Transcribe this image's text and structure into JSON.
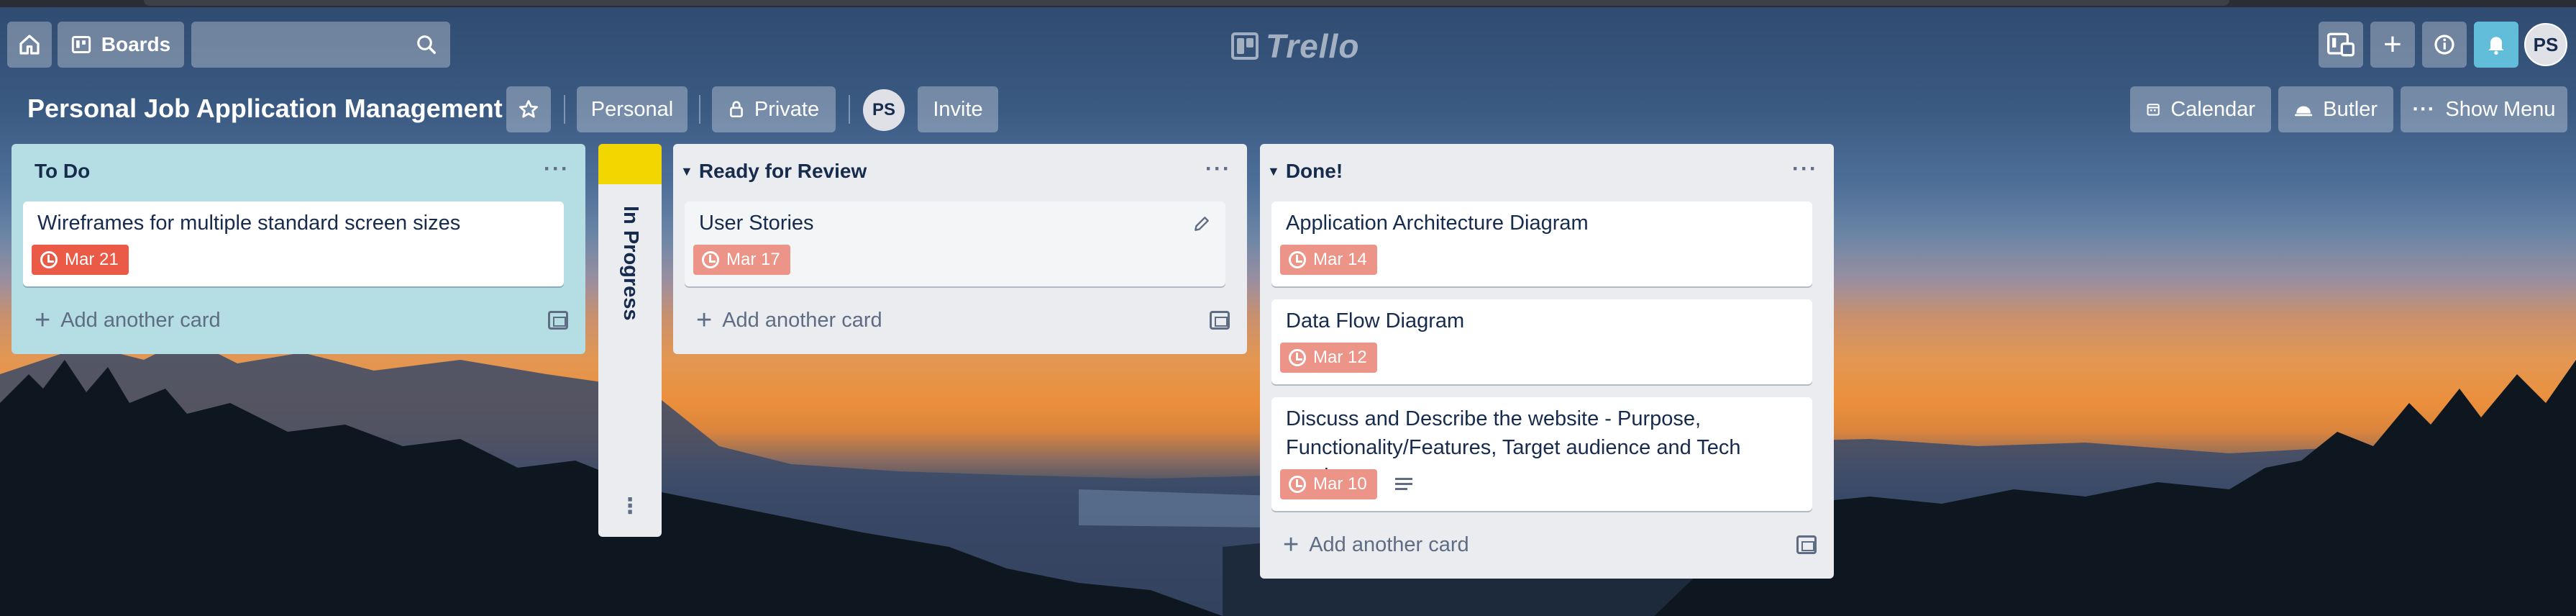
{
  "topbar": {
    "home_icon": "home-icon",
    "boards_label": "Boards",
    "search_placeholder": "",
    "logo_text": "Trello",
    "avatar_initials": "PS"
  },
  "board": {
    "title": "Personal Job Application Management",
    "personal_label": "Personal",
    "visibility_label": "Private",
    "member_initials": "PS",
    "invite_label": "Invite",
    "calendar_label": "Calendar",
    "butler_label": "Butler",
    "menu_label": "Show Menu"
  },
  "lists": [
    {
      "title": "To Do",
      "cards": [
        {
          "title": "Wireframes for multiple standard screen sizes",
          "due": "Mar 21"
        }
      ],
      "add_label": "Add another card"
    },
    {
      "title": "In Progress",
      "collapsed": true,
      "label_color": "#f2d600"
    },
    {
      "title": "Ready for Review",
      "cards": [
        {
          "title": "User Stories",
          "due": "Mar 17"
        }
      ],
      "add_label": "Add another card"
    },
    {
      "title": "Done!",
      "cards": [
        {
          "title": "Application Architecture Diagram",
          "due": "Mar 14"
        },
        {
          "title": "Data Flow Diagram",
          "due": "Mar 12"
        },
        {
          "title": "Discuss and Describe the website - Purpose, Functionality/Features, Target audience and Tech stack",
          "due": "Mar 10",
          "has_description": true
        }
      ],
      "add_label": "Add another card"
    }
  ],
  "colors": {
    "todo_list_bg": "#b4dde4",
    "list_bg": "#ebecf0",
    "due_badge": "#ec9488",
    "due_badge_overdue": "#eb5a46",
    "notification_button": "#61bdd9",
    "title_text": "#172b4d"
  }
}
